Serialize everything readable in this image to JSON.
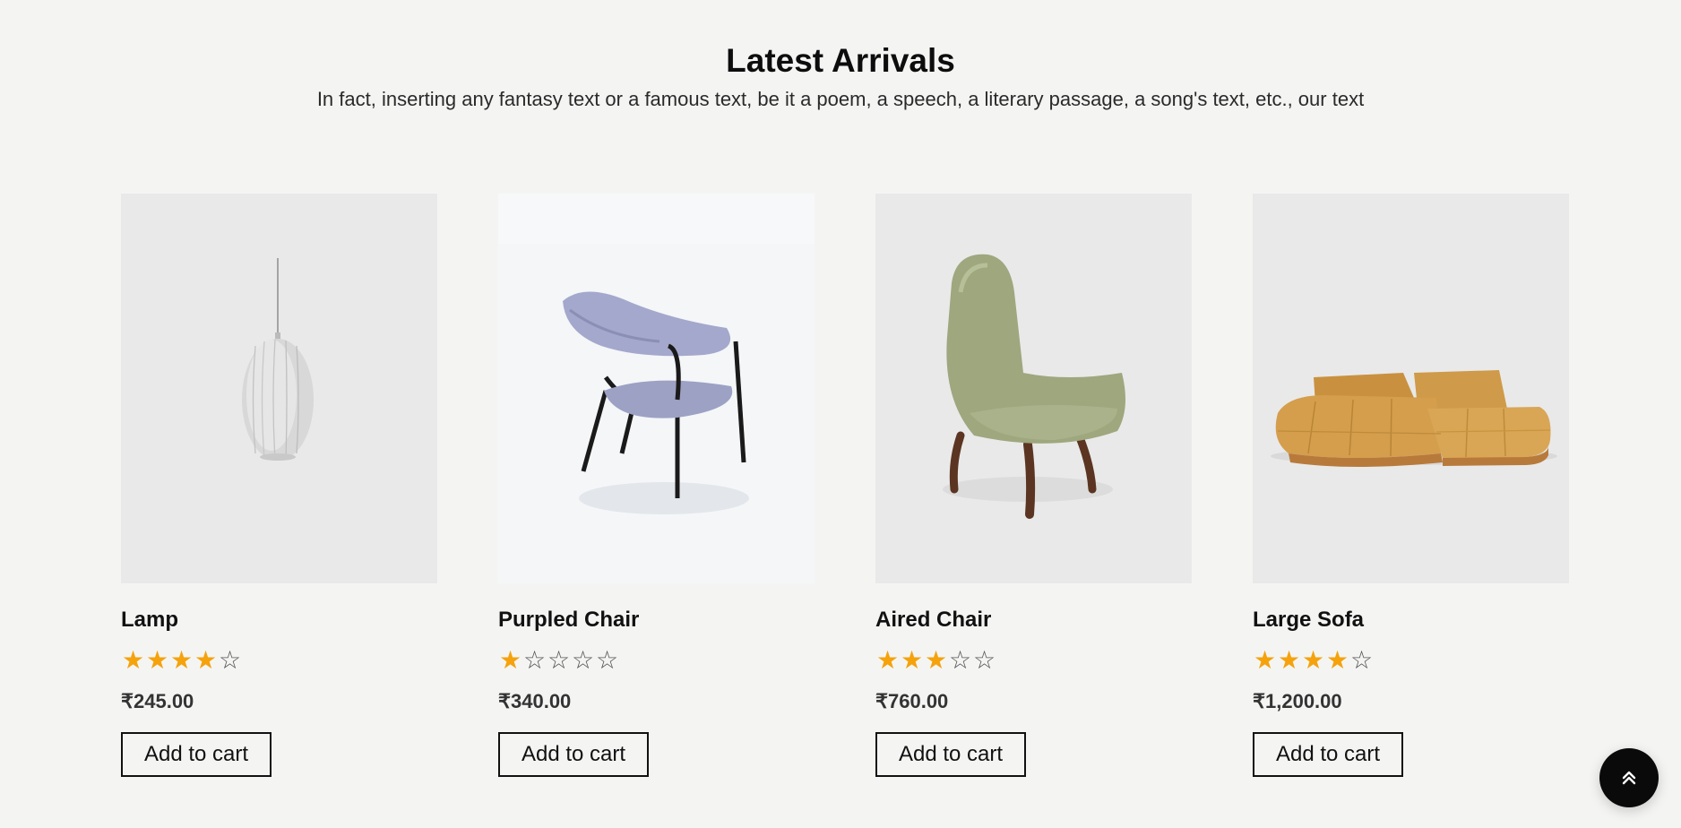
{
  "section": {
    "title": "Latest Arrivals",
    "subtitle": "In fact, inserting any fantasy text or a famous text, be it a poem, a speech, a literary passage, a song's text, etc., our text"
  },
  "products": [
    {
      "name": "Lamp",
      "rating": 4,
      "max_rating": 5,
      "price": "₹245.00",
      "cta": "Add to cart",
      "image": "pendant-lamp-image"
    },
    {
      "name": "Purpled Chair",
      "rating": 1,
      "max_rating": 5,
      "price": "₹340.00",
      "cta": "Add to cart",
      "image": "purple-chair-image"
    },
    {
      "name": "Aired Chair",
      "rating": 3,
      "max_rating": 5,
      "price": "₹760.00",
      "cta": "Add to cart",
      "image": "green-armchair-image"
    },
    {
      "name": "Large Sofa",
      "rating": 4,
      "max_rating": 5,
      "price": "₹1,200.00",
      "cta": "Add to cart",
      "image": "orange-sofa-image"
    }
  ],
  "back_to_top": {
    "icon": "double-chevron-up-icon"
  },
  "colors": {
    "background": "#f4f5f3",
    "star_filled": "#f5a20c",
    "star_empty": "#555555",
    "button_border": "#111111",
    "back_to_top_bg": "#0a0a0a"
  }
}
